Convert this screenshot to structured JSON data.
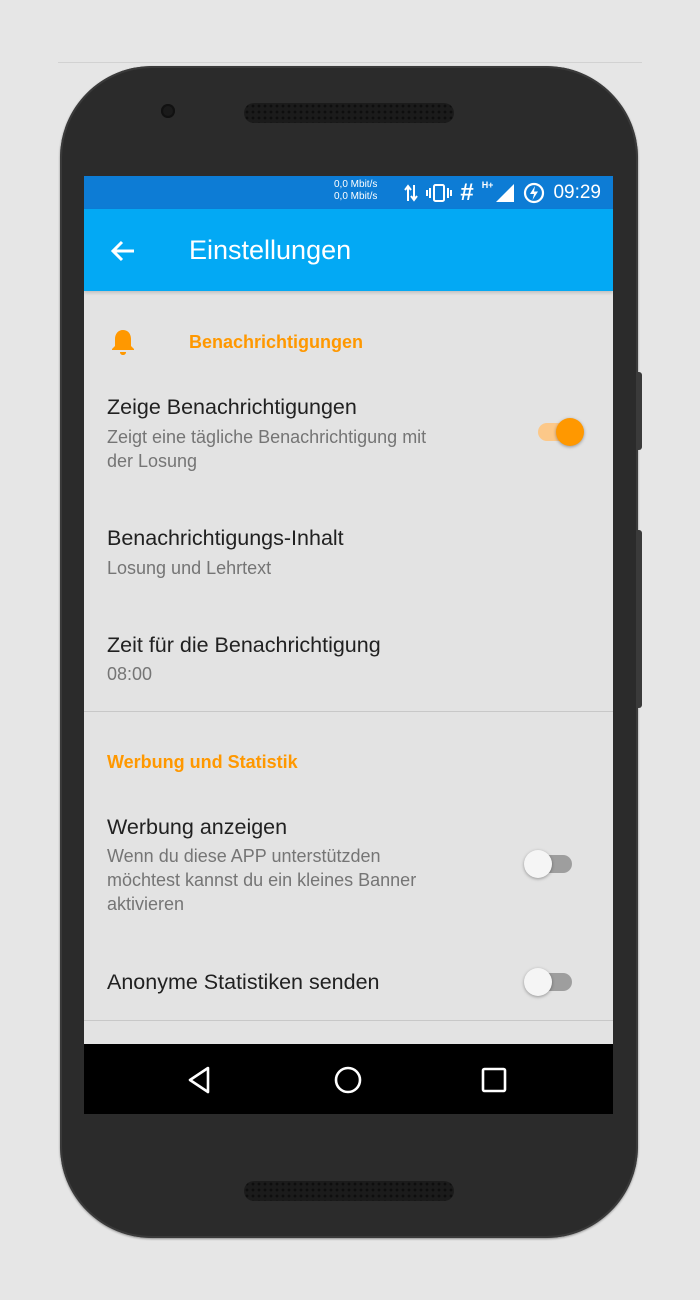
{
  "status_bar": {
    "net_speed_up": "0,0 Mbit/s",
    "net_speed_down": "0,0 Mbit/s",
    "hash_symbol": "#",
    "network_type": "H+",
    "time": "09:29",
    "icons": [
      "data-transfer-icon",
      "vibrate-icon",
      "signal-icon",
      "battery-charging-icon"
    ]
  },
  "app_bar": {
    "title": "Einstellungen",
    "color": "#03a9f4",
    "icons": [
      "back-arrow-icon"
    ]
  },
  "settings": {
    "notifications_category": {
      "title": "Benachrichtigungen",
      "icon": "bell-icon",
      "color": "#ff9800"
    },
    "show_notifications": {
      "title": "Zeige Benachrichtigungen",
      "summary_line1": "Zeigt eine tägliche Benachrichtigung mit",
      "summary_line2": "der Losung",
      "enabled": true
    },
    "notification_content": {
      "title": "Benachrichtigungs-Inhalt",
      "summary": "Losung und Lehrtext"
    },
    "notification_time": {
      "title": "Zeit für die Benachrichtigung",
      "summary": "08:00"
    },
    "ads_stats_category": {
      "title": "Werbung und Statistik",
      "color": "#ff9800"
    },
    "show_ads": {
      "title": "Werbung anzeigen",
      "summary_line1": "Wenn du diese APP unterstützden",
      "summary_line2": "möchtest kannst du ein kleines Banner",
      "summary_line3": "aktivieren",
      "enabled": false
    },
    "anonymous_stats": {
      "title": "Anonyme Statistiken senden",
      "enabled": false
    }
  },
  "nav_bar": {
    "icons": [
      "back-triangle-icon",
      "home-circle-icon",
      "recents-square-icon"
    ]
  }
}
